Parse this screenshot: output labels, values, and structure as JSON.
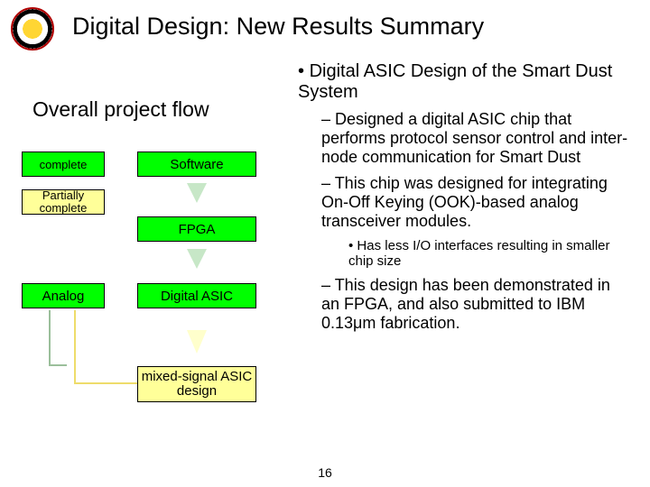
{
  "title": "Digital Design: New Results Summary",
  "flow": {
    "heading": "Overall project flow",
    "legend_complete": "complete",
    "legend_partial": "Partially complete",
    "software": "Software",
    "fpga": "FPGA",
    "digital_asic": "Digital ASIC",
    "mixed": "mixed-signal ASIC design",
    "analog": "Analog"
  },
  "bullets": {
    "main": "Digital ASIC Design of the Smart Dust System",
    "sub1": "Designed a digital ASIC chip that performs protocol sensor control and inter-node communication for Smart Dust",
    "sub2": "This chip was designed for integrating On-Off Keying (OOK)-based analog transceiver modules.",
    "sub2a": "Has less I/O interfaces resulting in smaller chip size",
    "sub3": "This design has been demonstrated in an FPGA, and also submitted to IBM 0.13μm fabrication."
  },
  "page": "16"
}
